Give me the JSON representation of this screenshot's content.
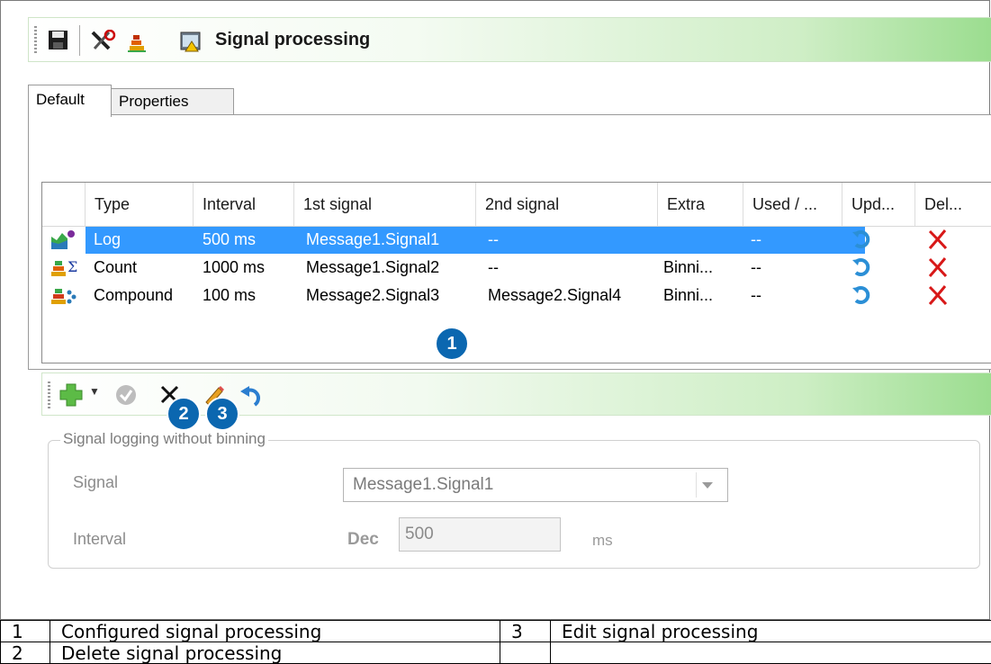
{
  "header": {
    "title": "Signal processing"
  },
  "toolbar_icons": [
    "save-icon",
    "tools-icon",
    "chart-icon",
    "signal-window-icon"
  ],
  "tabs": [
    {
      "label": "Default",
      "active": true
    },
    {
      "label": "Properties",
      "active": false
    }
  ],
  "grid": {
    "columns": [
      "Type",
      "Interval",
      "1st signal",
      "2nd signal",
      "Extra",
      "Used / ...",
      "Upd...",
      "Del..."
    ],
    "rows": [
      {
        "type": "Log",
        "interval": "500 ms",
        "first": "Message1.Signal1",
        "second": "--",
        "extra": "",
        "used": "--",
        "selected": true
      },
      {
        "type": "Count",
        "interval": "1000 ms",
        "first": "Message1.Signal2",
        "second": "--",
        "extra": "Binni...",
        "used": "--",
        "selected": false
      },
      {
        "type": "Compound",
        "interval": "100 ms",
        "first": "Message2.Signal3",
        "second": "Message2.Signal4",
        "extra": "Binni...",
        "used": "--",
        "selected": false
      }
    ]
  },
  "callouts": {
    "c1": "1",
    "c2": "2",
    "c3": "3"
  },
  "form": {
    "group_title": "Signal logging without binning",
    "signal_label": "Signal",
    "signal_value": "Message1.Signal1",
    "interval_label": "Interval",
    "interval_format": "Dec",
    "interval_value": "500",
    "interval_unit": "ms"
  },
  "legend": [
    {
      "num": "1",
      "text": "Configured signal processing"
    },
    {
      "num": "3",
      "text": "Edit signal processing"
    },
    {
      "num": "2",
      "text": "Delete signal processing"
    },
    {
      "num": "",
      "text": ""
    }
  ],
  "colors": {
    "selection": "#3399ff",
    "callout": "#0b67b0",
    "toolbar_green": "#9bdd8f"
  }
}
